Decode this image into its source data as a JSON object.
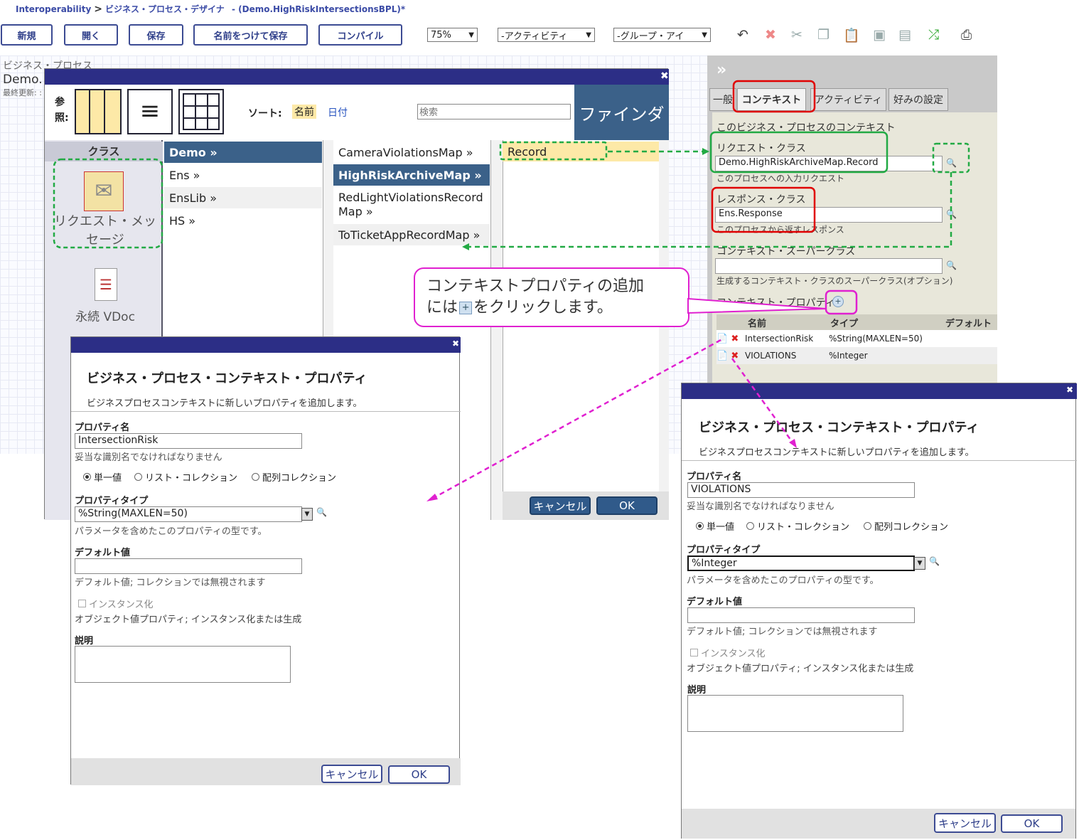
{
  "breadcrumb": {
    "root": "Interoperability",
    "separator": ">",
    "page": "ビジネス・プロセス・デザイナ",
    "doc": "- (Demo.HighRiskIntersectionsBPL)*"
  },
  "toolbar": {
    "new": "新規",
    "open": "開く",
    "save": "保存",
    "save_as": "名前をつけて保存",
    "compile": "コンパイル",
    "zoom": "75%",
    "activity_select": "-アクティビティ",
    "group_select": "-グループ・アイ"
  },
  "canvas": {
    "heading": "ビジネス・プロセス",
    "name": "Demo.",
    "updated": "最終更新: :"
  },
  "finder": {
    "browse_label": "参照:",
    "sort_label": "ソート:",
    "sort_name": "名前",
    "sort_date": "日付",
    "search_placeholder": "検索",
    "title": "ファインダ",
    "class_header": "クラス",
    "class_items": [
      {
        "label": "リクエスト・メッセージ"
      },
      {
        "label": "永続 VDoc"
      }
    ],
    "col1": [
      "Demo »",
      "Ens »",
      "EnsLib »",
      "HS »"
    ],
    "col2": [
      "CameraViolationsMap »",
      "HighRiskArchiveMap »",
      "RedLightViolationsRecord Map »",
      "ToTicketAppRecordMap »"
    ],
    "col3": [
      "Record"
    ],
    "cancel": "キャンセル",
    "ok": "OK"
  },
  "panel": {
    "expand": "»",
    "tabs": [
      "一般",
      "コンテキスト",
      "アクティビティ",
      "好みの設定"
    ],
    "section_title": "このビジネス・プロセスのコンテキスト",
    "request_label": "リクエスト・クラス",
    "request_value": "Demo.HighRiskArchiveMap.Record",
    "request_hint": "このプロセスへの入力リクエスト",
    "response_label": "レスポンス・クラス",
    "response_value": "Ens.Response",
    "response_hint": "このプロセスから返すレスポンス",
    "super_label": "コンテキスト・スーパークラス",
    "super_value": "",
    "super_hint": "生成するコンテキスト・クラスのスーパークラス(オプション)",
    "props_label": "コンテキスト・プロパティ",
    "cols": [
      "名前",
      "タイプ",
      "デフォルト"
    ],
    "rows": [
      {
        "name": "IntersectionRisk",
        "type": "%String(MAXLEN=50)"
      },
      {
        "name": "VIOLATIONS",
        "type": "%Integer"
      }
    ]
  },
  "callout": {
    "line1": "コンテキストプロパティの追加",
    "line2a": "には",
    "line2b": "をクリックします。"
  },
  "dialog_common": {
    "title": "ビジネス・プロセス・コンテキスト・プロパティ",
    "subtitle": "ビジネスプロセスコンテキストに新しいプロパティを追加します。",
    "name_label": "プロパティ名",
    "name_hint": "妥当な識別名でなければなりません",
    "radio_single": "単一値",
    "radio_list": "リスト・コレクション",
    "radio_array": "配列コレクション",
    "type_label": "プロパティタイプ",
    "type_hint": "パラメータを含めたこのプロパティの型です。",
    "default_label": "デフォルト値",
    "default_hint": "デフォルト値; コレクションでは無視されます",
    "instantiate": "インスタンス化",
    "instantiate_hint": "オブジェクト値プロパティ; インスタンス化または生成",
    "desc_label": "説明",
    "cancel": "キャンセル",
    "ok": "OK"
  },
  "dialog1": {
    "name_value": "IntersectionRisk",
    "type_value": "%String(MAXLEN=50)",
    "default_value": ""
  },
  "dialog2": {
    "name_value": "VIOLATIONS",
    "type_value": "%Integer",
    "default_value": ""
  },
  "colors": {
    "dialog_bar": "#2c2e86",
    "selected": "#3b6189",
    "highlight": "#fde9a7",
    "annot_red": "#e00000",
    "annot_green": "#22aa44",
    "annot_magenta": "#e020d0"
  }
}
